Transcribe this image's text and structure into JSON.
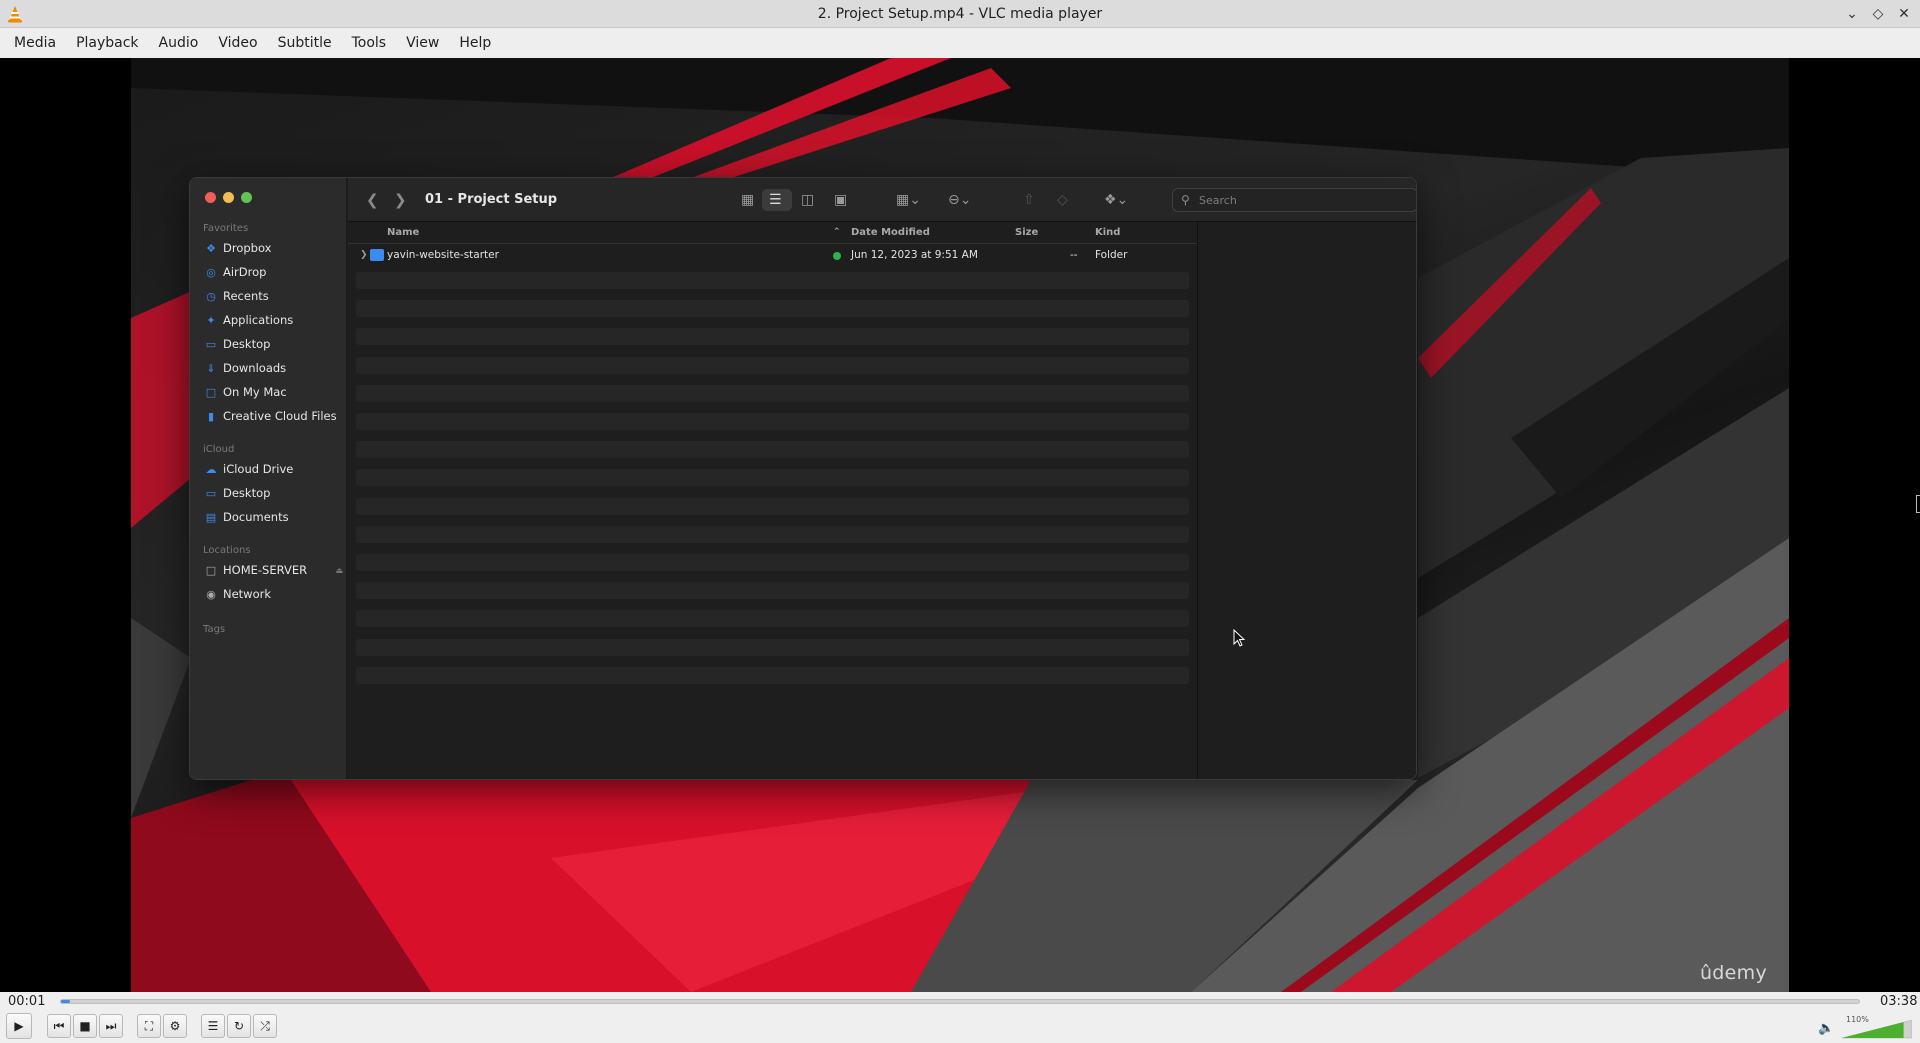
{
  "window": {
    "title": "2. Project Setup.mp4 - VLC media player",
    "controls": [
      "minimize-icon",
      "maximize-icon",
      "close-icon"
    ]
  },
  "menubar": [
    "Media",
    "Playback",
    "Audio",
    "Video",
    "Subtitle",
    "Tools",
    "View",
    "Help"
  ],
  "video": {
    "watermark": "ûdemy",
    "finder": {
      "folder_title": "01 - Project Setup",
      "search_placeholder": "Search",
      "sidebar": {
        "favorites_label": "Favorites",
        "favorites": [
          "Dropbox",
          "AirDrop",
          "Recents",
          "Applications",
          "Desktop",
          "Downloads",
          "On My Mac",
          "Creative Cloud Files"
        ],
        "icloud_label": "iCloud",
        "icloud": [
          "iCloud Drive",
          "Desktop",
          "Documents"
        ],
        "locations_label": "Locations",
        "locations": [
          "HOME-SERVER",
          "Network"
        ],
        "tags_label": "Tags"
      },
      "columns": {
        "name": "Name",
        "date": "Date Modified",
        "size": "Size",
        "kind": "Kind"
      },
      "rows": [
        {
          "name": "yavin-website-starter",
          "date": "Jun 12, 2023 at 9:51 AM",
          "size": "--",
          "kind": "Folder"
        }
      ]
    }
  },
  "playback": {
    "elapsed": "00:01",
    "total": "03:38",
    "progress": 0.005,
    "volume_label": "110%",
    "volume": 1.1
  },
  "colors": {
    "accent": "#3c8cf0",
    "finder_bg": "#1e1e1e",
    "red": "#e8102a"
  }
}
